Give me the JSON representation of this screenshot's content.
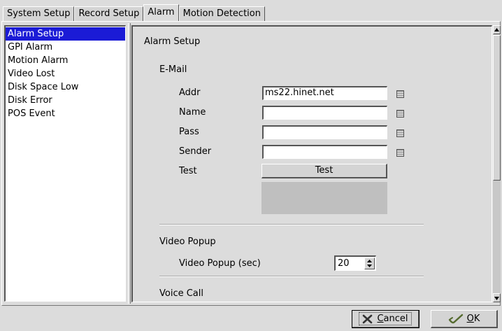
{
  "tabs": [
    {
      "label": "System Setup"
    },
    {
      "label": "Record Setup"
    },
    {
      "label": "Alarm"
    },
    {
      "label": "Motion Detection"
    }
  ],
  "sidebar": {
    "items": [
      {
        "label": "Alarm Setup"
      },
      {
        "label": "GPI Alarm"
      },
      {
        "label": "Motion Alarm"
      },
      {
        "label": "Video Lost"
      },
      {
        "label": "Disk Space Low"
      },
      {
        "label": "Disk Error"
      },
      {
        "label": "POS Event"
      }
    ],
    "selected": "Alarm Setup"
  },
  "panel": {
    "title": "Alarm Setup",
    "email": {
      "heading": "E-Mail",
      "addr_label": "Addr",
      "addr_value": "ms22.hinet.net",
      "name_label": "Name",
      "name_value": "",
      "pass_label": "Pass",
      "pass_value": "",
      "sender_label": "Sender",
      "sender_value": "",
      "test_label": "Test",
      "test_button": "Test"
    },
    "video_popup": {
      "heading": "Video Popup",
      "sec_label": "Video Popup (sec)",
      "sec_value": "20"
    },
    "voice_call": {
      "heading": "Voice Call"
    }
  },
  "footer": {
    "cancel_label": "Cancel",
    "cancel_mnemonic": "C",
    "cancel_rest": "ancel",
    "ok_label": "OK",
    "ok_mnemonic": "O",
    "ok_rest": "K"
  },
  "icons": {
    "cancel": "x-icon",
    "ok": "check-pen-icon",
    "field_picker": "list-picker-icon"
  },
  "colors": {
    "selection": "#1b1bd6",
    "background": "#dcdcdc"
  }
}
